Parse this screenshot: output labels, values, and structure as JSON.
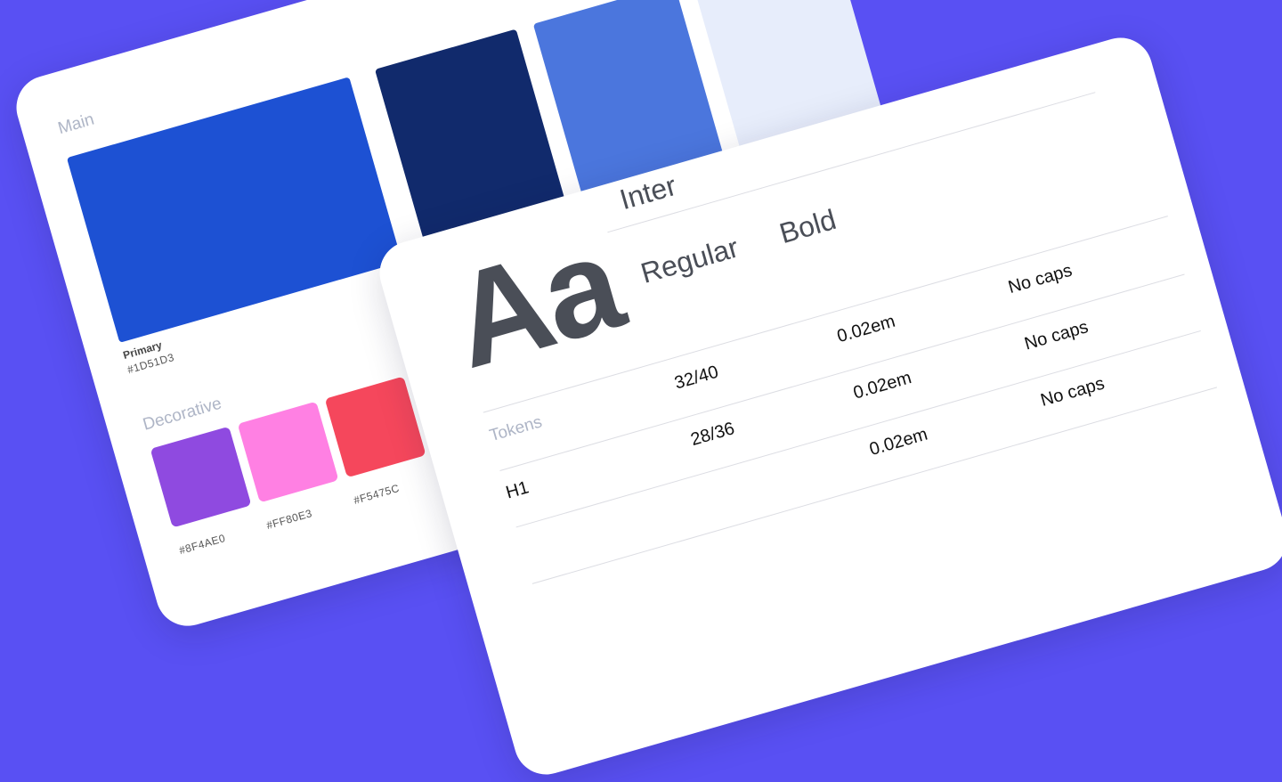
{
  "palette": {
    "main_label": "Main",
    "primary": {
      "name": "Primary",
      "hex": "#1D51D3"
    },
    "shades": [
      "#112A6C",
      "#4B76DD",
      "#E7EDFB"
    ],
    "decorative_label": "Decorative",
    "decorative": [
      {
        "hex": "#8F4AE0"
      },
      {
        "hex": "#FF80E3"
      },
      {
        "hex": "#F5475C"
      }
    ]
  },
  "typography": {
    "sample": "Aa",
    "font_name": "Inter",
    "weights": [
      "Regular",
      "Bold"
    ],
    "tokens_label": "Tokens",
    "rows": [
      {
        "name": "H1",
        "size": "32/40",
        "spacing": "0.02em",
        "caps": "No caps"
      },
      {
        "name": "",
        "size": "28/36",
        "spacing": "0.02em",
        "caps": "No caps"
      },
      {
        "name": "",
        "size": "",
        "spacing": "0.02em",
        "caps": "No caps"
      }
    ]
  },
  "colors": {
    "background": "#5950F3",
    "card": "#FFFFFF",
    "text_dark": "#4A4E57",
    "text_muted": "#AEB5C6"
  }
}
